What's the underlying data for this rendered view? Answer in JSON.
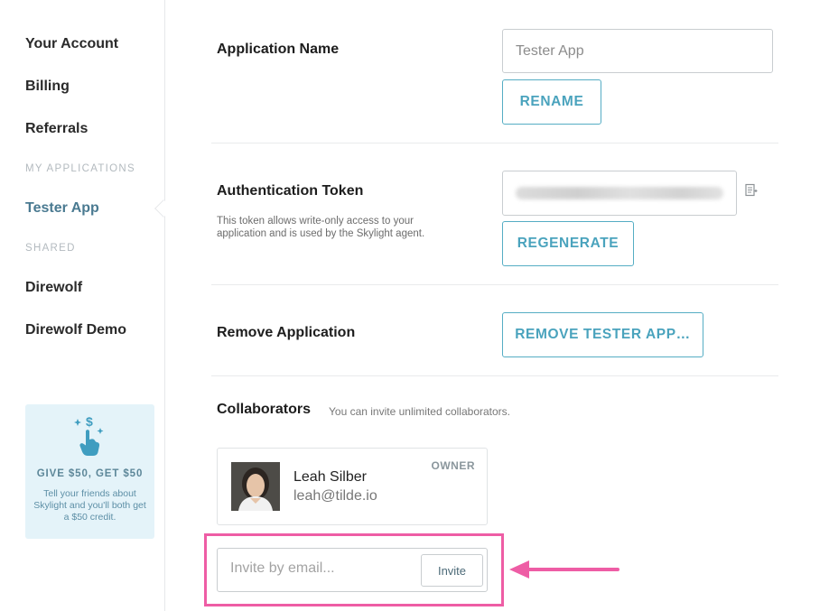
{
  "sidebar": {
    "account_items": [
      "Your Account",
      "Billing",
      "Referrals"
    ],
    "section_my_apps": "MY APPLICATIONS",
    "active_app": "Tester App",
    "section_shared": "SHARED",
    "shared_apps": [
      "Direwolf",
      "Direwolf Demo"
    ],
    "promo": {
      "title": "GIVE $50, GET $50",
      "text": "Tell your friends about Skylight and you'll both get a $50 credit.",
      "icon": "tap-dollar-icon"
    }
  },
  "app_name": {
    "label": "Application Name",
    "value": "Tester App",
    "button": "RENAME"
  },
  "auth_token": {
    "label": "Authentication Token",
    "description": "This token allows write-only access to your application and is used by the Skylight agent.",
    "button": "REGENERATE",
    "copy_icon": "copy-icon"
  },
  "remove": {
    "label": "Remove Application",
    "button": "REMOVE TESTER APP…"
  },
  "collaborators": {
    "label": "Collaborators",
    "subtitle": "You can invite unlimited collaborators.",
    "list": [
      {
        "name": "Leah Silber",
        "email": "leah@tilde.io",
        "role": "OWNER"
      }
    ],
    "invite_placeholder": "Invite by email...",
    "invite_button": "Invite"
  },
  "annotation": {
    "highlight_color": "#ee5da5"
  },
  "colors": {
    "accent": "#4aa3bd",
    "active_nav": "#4a7a91",
    "promo_bg": "#e4f3f9"
  }
}
